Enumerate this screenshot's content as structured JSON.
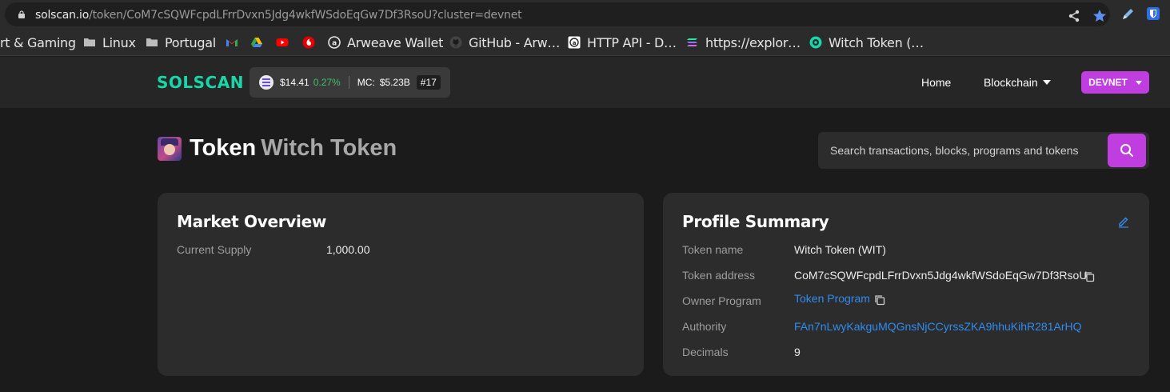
{
  "browser": {
    "url_host": "solscan.io",
    "url_path": "/token/CoM7cSQWFcpdLFrrDvxn5Jdg4wkfWSdoEqGw7Df3RsoU?cluster=devnet",
    "bookmarks": [
      {
        "label": "rt & Gaming",
        "icon": "folder-icon"
      },
      {
        "label": "Linux",
        "icon": "folder-icon"
      },
      {
        "label": "Portugal",
        "icon": "folder-icon"
      },
      {
        "label": "",
        "icon": "gmail-icon"
      },
      {
        "label": "",
        "icon": "google-drive-icon"
      },
      {
        "label": "",
        "icon": "youtube-icon"
      },
      {
        "label": "",
        "icon": "vodafone-icon"
      },
      {
        "label": "Arweave Wallet",
        "icon": "arweave-icon"
      },
      {
        "label": "GitHub - Arw…",
        "icon": "github-icon"
      },
      {
        "label": "HTTP API - D…",
        "icon": "arweave-doc-icon"
      },
      {
        "label": "https://explor…",
        "icon": "solana-icon"
      },
      {
        "label": "Witch Token (…",
        "icon": "solscan-icon"
      }
    ]
  },
  "header": {
    "logo": "SOLSCAN",
    "sol_price": "$14.41",
    "sol_change": "0.27%",
    "mc_label": "MC:",
    "mc_value": "$5.23B",
    "rank": "#17",
    "nav_home": "Home",
    "nav_blockchain": "Blockchain",
    "cluster": "DEVNET"
  },
  "title": {
    "prefix": "Token",
    "name": "Witch Token"
  },
  "search": {
    "placeholder": "Search transactions, blocks, programs and tokens"
  },
  "market": {
    "heading": "Market Overview",
    "supply_label": "Current Supply",
    "supply_value": "1,000.00"
  },
  "profile": {
    "heading": "Profile Summary",
    "rows": [
      {
        "label": "Token name",
        "value": "Witch Token (WIT)"
      },
      {
        "label": "Token address",
        "value": "CoM7cSQWFcpdLFrrDvxn5Jdg4wkfWSdoEqGw7Df3RsoU"
      },
      {
        "label": "Owner Program",
        "value": "Token Program"
      },
      {
        "label": "Authority",
        "value": "FAn7nLwyKakguMQGnsNjCCyrssZKA9hhuKihR281ArHQ"
      },
      {
        "label": "Decimals",
        "value": "9"
      }
    ]
  },
  "colors": {
    "accent": "#c03de0",
    "logo": "#18d6a8",
    "link": "#2f8cf0",
    "positive": "#3fbf6f"
  }
}
